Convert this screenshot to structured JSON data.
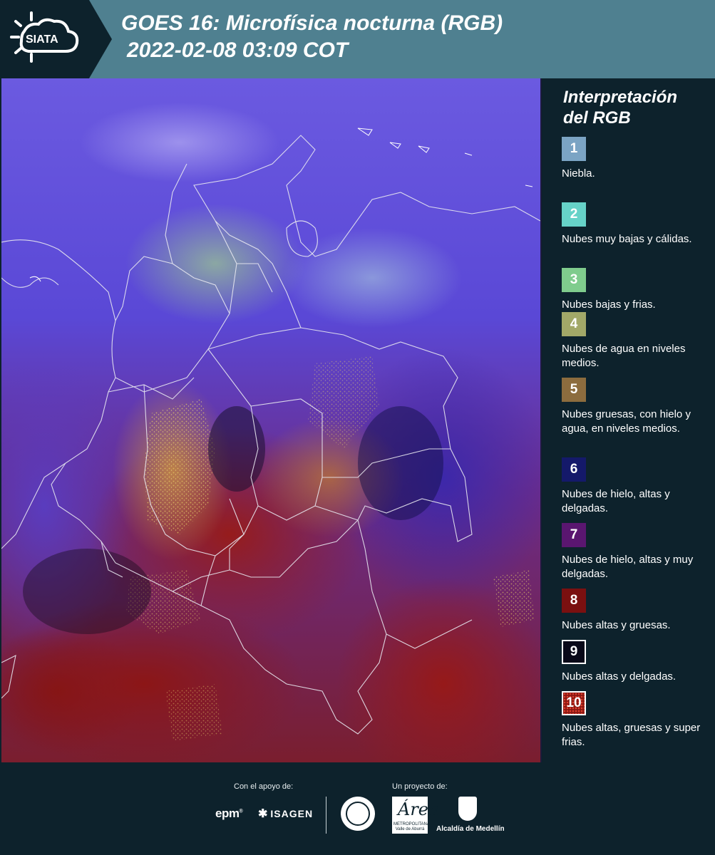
{
  "header": {
    "logo_text": "SIATA",
    "title_line1": "GOES 16: Microfísica nocturna (RGB)",
    "title_line2": "2022-02-08 03:09 COT",
    "bg_color": "#4f8090"
  },
  "legend": {
    "title_line1": "Interpretación",
    "title_line2": "del RGB",
    "items": [
      {
        "number": "1",
        "color": "#7ba4c4",
        "label": "Niebla."
      },
      {
        "number": "2",
        "color": "#66d2c8",
        "label": "Nubes muy bajas y cálidas."
      },
      {
        "number": "3",
        "color": "#7fcc8d",
        "label": "Nubes bajas y frias."
      },
      {
        "number": "4",
        "color": "#a2a868",
        "label": "Nubes de agua en niveles medios."
      },
      {
        "number": "5",
        "color": "#8c6c3e",
        "label": "Nubes gruesas, con hielo y agua, en niveles medios."
      },
      {
        "number": "6",
        "color": "#14196a",
        "label": "Nubes de hielo, altas y delgadas."
      },
      {
        "number": "7",
        "color": "#5a1670",
        "label": "Nubes de hielo, altas y muy delgadas."
      },
      {
        "number": "8",
        "color": "#7a1010",
        "label": "Nubes altas y gruesas."
      },
      {
        "number": "9",
        "color": "#080818",
        "label": "Nubes altas y delgadas."
      },
      {
        "number": "10",
        "color": "#8a1812",
        "label": "Nubes altas, gruesas y super frias."
      }
    ]
  },
  "footer": {
    "support_caption": "Con el apoyo de:",
    "project_caption": "Un proyecto de:",
    "epm": "epm",
    "isagen": "ISAGEN",
    "area_logo_letter": "Área",
    "area_logo_text": "METROPOLITANA Valle de Aburrá",
    "medellin": "Alcaldía de Medellín"
  }
}
